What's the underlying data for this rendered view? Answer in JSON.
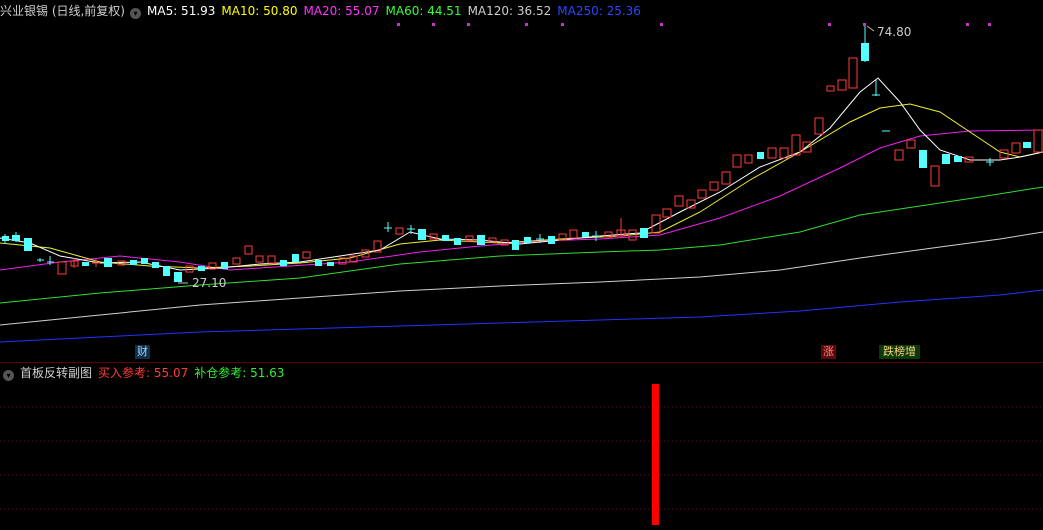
{
  "main_legend": {
    "title": "兴业银锡 (日线,前复权)",
    "ma": [
      {
        "label": "MA5: 51.93",
        "color": "#ffffff"
      },
      {
        "label": "MA10: 50.80",
        "color": "#ffff00"
      },
      {
        "label": "MA20: 55.07",
        "color": "#ff00ff"
      },
      {
        "label": "MA60: 44.51",
        "color": "#00ff00"
      },
      {
        "label": "MA120: 36.52",
        "color": "#cccccc"
      },
      {
        "label": "MA250: 25.36",
        "color": "#1f3cff"
      }
    ]
  },
  "price_labels": {
    "high": "74.80",
    "low": "27.10"
  },
  "markers": {
    "cai": "财",
    "zhang": "涨",
    "diebang": "跌榜增"
  },
  "sub_legend": {
    "title": "首板反转副图",
    "buy": "买入参考: 55.07",
    "add": "补仓参考: 51.63"
  },
  "colors": {
    "up": "#ff3b3b",
    "down": "#54ffff",
    "bg": "#000000"
  }
}
